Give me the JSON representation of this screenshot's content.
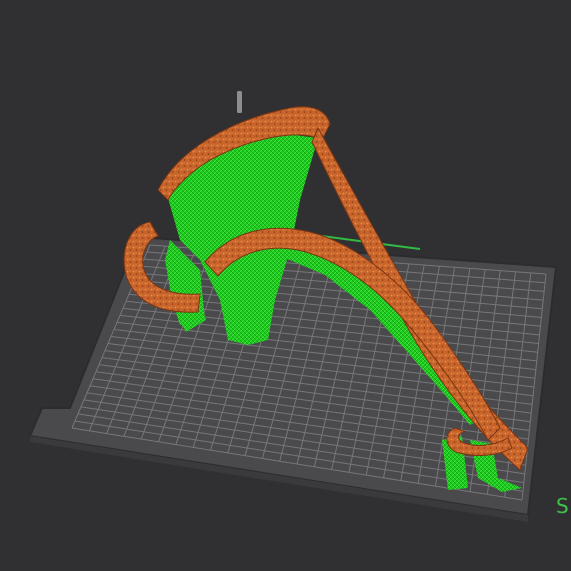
{
  "viewport": {
    "background_color": "#303032",
    "bed_color": "#4a4a4d",
    "bed_edge_color": "#2c2c2e",
    "grid_line_color": "#77777a",
    "model_color": "#c8642a",
    "model_highlight_color": "#e8904a",
    "support_color": "#1fc81f",
    "support_highlight_color": "#5aff5a",
    "axis_z_color": "#8e8e91",
    "axis_x_color": "#33bb44",
    "edge_label_text": "S"
  },
  "icons": {
    "axis_indicator": "z-axis-icon"
  }
}
